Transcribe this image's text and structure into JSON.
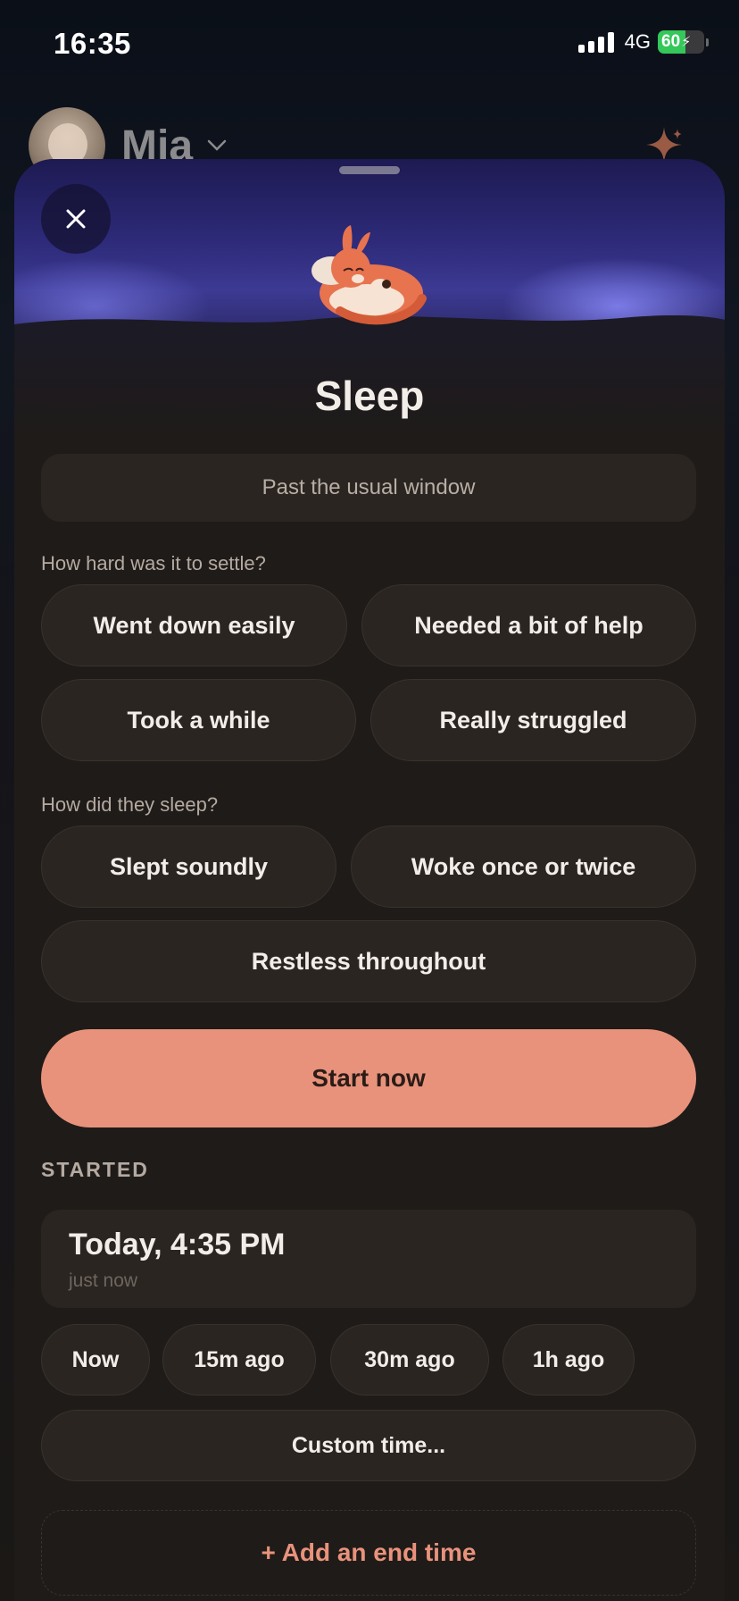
{
  "status_bar": {
    "time": "16:35",
    "network": "4G",
    "battery_percent": "60",
    "battery_level": 0.6,
    "battery_color": "#34c759"
  },
  "profile": {
    "name": "Mia",
    "chevron_icon": "chevron-down-icon",
    "sparkle_icon": "sparkle-icon"
  },
  "sheet": {
    "close_icon": "close-icon",
    "mascot_icon": "sleeping-kangaroo-icon",
    "title": "Sleep",
    "window_status": "Past the usual window",
    "settle": {
      "question": "How hard was it to settle?",
      "options": [
        "Went down easily",
        "Needed a bit of help",
        "Took a while",
        "Really struggled"
      ]
    },
    "quality": {
      "question": "How did they sleep?",
      "options": [
        "Slept soundly",
        "Woke once or twice",
        "Restless throughout"
      ]
    },
    "start_button": "Start now",
    "started": {
      "label": "STARTED",
      "time": "Today, 4:35 PM",
      "relative": "just now",
      "quick_options": [
        "Now",
        "15m ago",
        "30m ago",
        "1h ago"
      ],
      "custom": "Custom time...",
      "add_end": "+ Add an end time"
    }
  },
  "colors": {
    "accent": "#e8927c",
    "surface": "#2a2521",
    "header_indigo": "#2e2b7a"
  }
}
